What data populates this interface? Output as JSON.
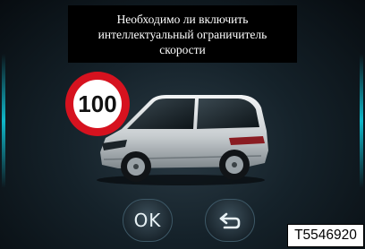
{
  "dialog": {
    "prompt_lines": [
      "Необходимо ли включить",
      "интеллектуальный ограничитель",
      "скорости"
    ]
  },
  "speed_sign": {
    "value": "100"
  },
  "buttons": {
    "ok_label": "OK",
    "back_icon": "return-arrow-icon"
  },
  "figure_reference": "T5546920",
  "colors": {
    "accent": "#0fb7c9",
    "sign_ring": "#d6121f"
  }
}
